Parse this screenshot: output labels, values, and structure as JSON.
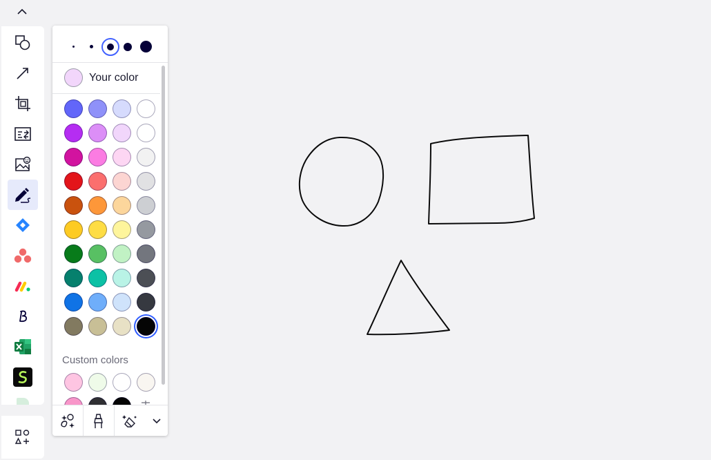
{
  "toolbar": {
    "tools": [
      {
        "id": "shapes",
        "icon": "shapes-icon",
        "active": false
      },
      {
        "id": "connection-line",
        "icon": "arrow-line-icon",
        "active": false
      },
      {
        "id": "frame",
        "icon": "frame-icon",
        "active": false
      },
      {
        "id": "cards",
        "icon": "cards-icon",
        "active": false
      },
      {
        "id": "upload",
        "icon": "image-upload-icon",
        "active": false
      },
      {
        "id": "pen",
        "icon": "pen-icon",
        "active": true
      },
      {
        "id": "jira",
        "icon": "jira-icon",
        "active": false
      },
      {
        "id": "asana",
        "icon": "asana-icon",
        "active": false
      },
      {
        "id": "monday",
        "icon": "monday-icon",
        "active": false
      },
      {
        "id": "bold-b",
        "icon": "b-logo-icon",
        "active": false
      },
      {
        "id": "excel",
        "icon": "excel-icon",
        "active": false
      },
      {
        "id": "s-app",
        "icon": "s-app-icon",
        "active": false
      }
    ],
    "more_apps_icon": "apps-plus-icon"
  },
  "pen_panel": {
    "stroke_sizes": [
      1,
      2,
      3,
      4,
      5
    ],
    "selected_size": 3,
    "your_color": {
      "label": "Your color",
      "color": "#f2d6fb"
    },
    "palette": [
      [
        "#6266f9",
        "#8f91f9",
        "#d6dbfd",
        "#ffffff"
      ],
      [
        "#b52df2",
        "#dc8ef7",
        "#f1d6fb",
        "#ffffff"
      ],
      [
        "#d2139f",
        "#fb7ce2",
        "#fdd6f3",
        "#f2f2f2"
      ],
      [
        "#e3151a",
        "#fb6f6e",
        "#fcd5d2",
        "#e1e1e3"
      ],
      [
        "#c9520e",
        "#fd9739",
        "#fcd69c",
        "#cdcfd3"
      ],
      [
        "#fdcb23",
        "#fedd44",
        "#fef59c",
        "#9599a0"
      ],
      [
        "#087b1a",
        "#58c063",
        "#c1f2c4",
        "#73767e"
      ],
      [
        "#06806d",
        "#0cc1a5",
        "#b9f3e6",
        "#4c4f55"
      ],
      [
        "#1073e5",
        "#6faefa",
        "#cfe3fb",
        "#363940"
      ],
      [
        "#827a60",
        "#c8bf96",
        "#e8e1c5",
        "#050505"
      ]
    ],
    "selected_color": "#050505",
    "custom_colors_label": "Custom colors",
    "custom_colors": [
      [
        "#fec5e2",
        "#effbe9",
        "#ffffff",
        "#f9f6f1"
      ],
      [
        "#f896c9",
        "#2f2f33",
        "#050505",
        ""
      ]
    ],
    "footer": {
      "shape_recognition_icon": "shape-recognition-icon",
      "highlighter_icon": "highlighter-icon",
      "eraser_icon": "eraser-icon",
      "more_icon": "chevron-down-icon"
    }
  },
  "canvas": {
    "drawings": [
      "circle",
      "rectangle",
      "triangle"
    ]
  }
}
